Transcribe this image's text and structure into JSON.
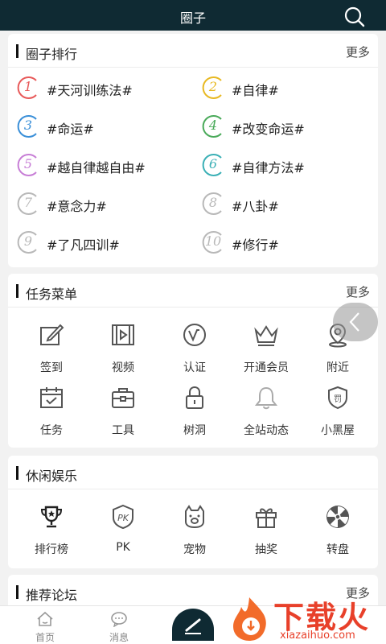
{
  "header": {
    "title": "圈子",
    "search_icon": "search-icon"
  },
  "ranking": {
    "title": "圈子排行",
    "more": "更多",
    "items": [
      {
        "rank": "1",
        "label": "#天河训练法#",
        "color": "#e85a5a"
      },
      {
        "rank": "2",
        "label": "#自律#",
        "color": "#e8b923"
      },
      {
        "rank": "3",
        "label": "#命运#",
        "color": "#3a8fd8"
      },
      {
        "rank": "4",
        "label": "#改变命运#",
        "color": "#4aaa5a"
      },
      {
        "rank": "5",
        "label": "#越自律越自由#",
        "color": "#c77ed6"
      },
      {
        "rank": "6",
        "label": "#自律方法#",
        "color": "#3bb0b6"
      },
      {
        "rank": "7",
        "label": "#意念力#",
        "color": "#b8b8b8"
      },
      {
        "rank": "8",
        "label": "#八卦#",
        "color": "#b8b8b8"
      },
      {
        "rank": "9",
        "label": "#了凡四训#",
        "color": "#b8b8b8"
      },
      {
        "rank": "10",
        "label": "#修行#",
        "color": "#b8b8b8"
      }
    ]
  },
  "tasks": {
    "title": "任务菜单",
    "more": "更多",
    "items": [
      {
        "label": "签到",
        "icon": "edit-icon"
      },
      {
        "label": "视频",
        "icon": "video-icon"
      },
      {
        "label": "认证",
        "icon": "verify-icon"
      },
      {
        "label": "开通会员",
        "icon": "crown-icon"
      },
      {
        "label": "附近",
        "icon": "location-icon"
      },
      {
        "label": "任务",
        "icon": "calendar-check-icon"
      },
      {
        "label": "工具",
        "icon": "toolbox-icon"
      },
      {
        "label": "树洞",
        "icon": "lock-icon"
      },
      {
        "label": "全站动态",
        "icon": "bell-icon"
      },
      {
        "label": "小黑屋",
        "icon": "penalty-shield-icon"
      }
    ]
  },
  "leisure": {
    "title": "休闲娱乐",
    "items": [
      {
        "label": "排行榜",
        "icon": "trophy-icon"
      },
      {
        "label": "PK",
        "icon": "pk-icon"
      },
      {
        "label": "宠物",
        "icon": "pet-icon"
      },
      {
        "label": "抽奖",
        "icon": "gift-icon"
      },
      {
        "label": "转盘",
        "icon": "wheel-icon"
      }
    ]
  },
  "forum": {
    "title": "推荐论坛",
    "more": "更多"
  },
  "bottom_nav": {
    "home": "首页",
    "messages": "消息"
  },
  "watermark": {
    "title": "下载火",
    "url": "xiazaihuo.com"
  }
}
